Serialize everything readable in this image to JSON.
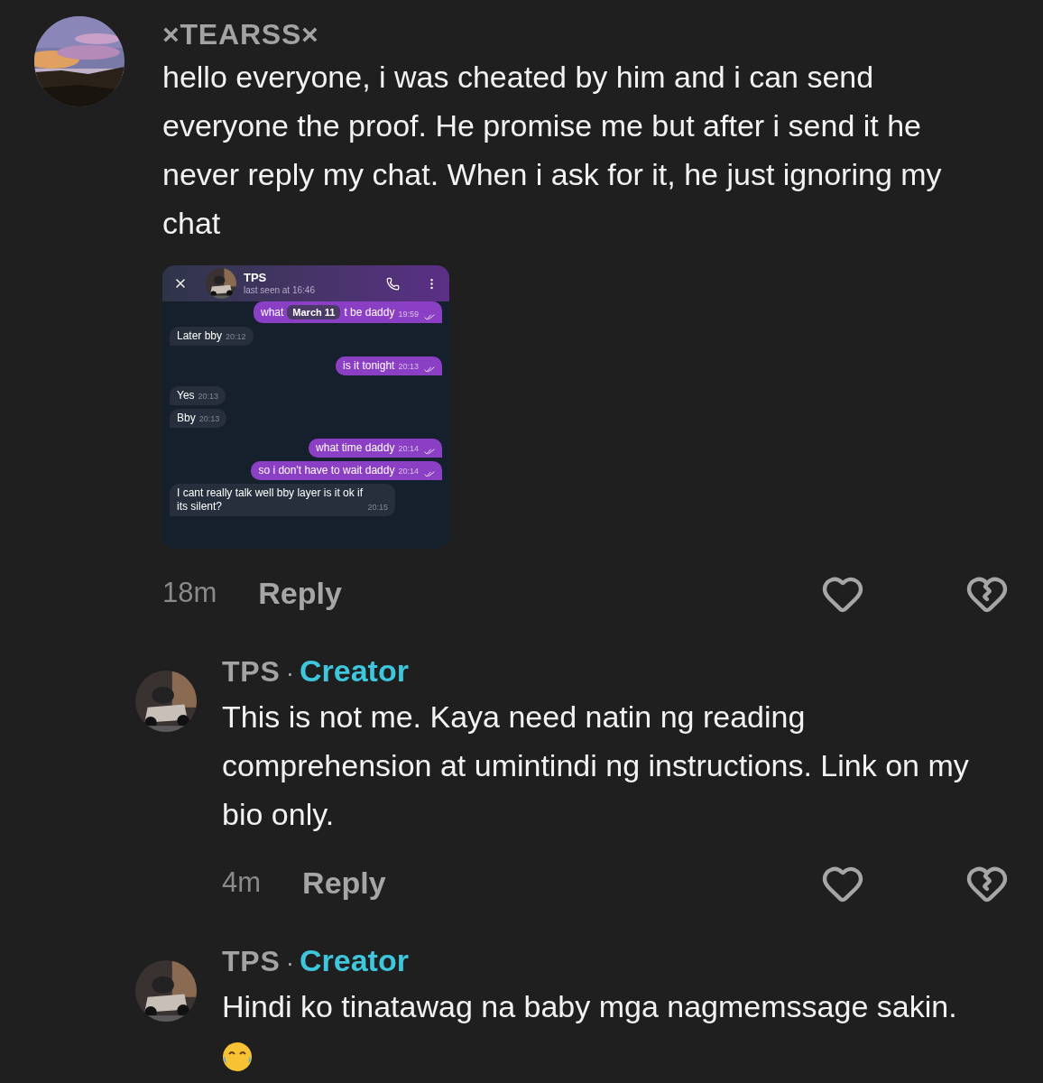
{
  "comments": [
    {
      "kind": "comment",
      "author": "×TEARSS×",
      "text": "hello everyone, i was cheated by him and i can send everyone the proof. He promise me but after i send it he never reply my chat. When i ask for it, he just ignoring my chat",
      "attachment": {
        "kind": "chat_screenshot",
        "title": "TPS",
        "status": "last seen at 16:46",
        "date_pill": "March 11",
        "messages": [
          {
            "kind": "sent",
            "parts": [
              "what",
              "t be daddy"
            ],
            "covered_by_date": true,
            "time": "19:59"
          },
          {
            "kind": "received",
            "parts": [
              "Later bby"
            ],
            "covered_by_date": false,
            "time": "20:12"
          },
          {
            "kind": "sent",
            "parts": [
              "is it tonight"
            ],
            "covered_by_date": false,
            "time": "20:13"
          },
          {
            "kind": "received",
            "parts": [
              "Yes"
            ],
            "covered_by_date": false,
            "time": "20:13"
          },
          {
            "kind": "received",
            "parts": [
              "Bby"
            ],
            "covered_by_date": false,
            "time": "20:13"
          },
          {
            "kind": "sent",
            "parts": [
              "what time daddy"
            ],
            "covered_by_date": false,
            "time": "20:14"
          },
          {
            "kind": "sent",
            "parts": [
              "so i don't have to wait daddy"
            ],
            "covered_by_date": false,
            "time": "20:14"
          },
          {
            "kind": "received",
            "parts": [
              "I cant really talk well bby layer is it ok if its silent?"
            ],
            "covered_by_date": false,
            "time": "20:15"
          }
        ]
      },
      "time": "18m",
      "reply_label": "Reply"
    },
    {
      "kind": "reply",
      "author": "TPS",
      "separator": "·",
      "badge": "Creator",
      "text": "This is not me. Kaya need natin ng reading comprehension at umintindi ng instructions. Link on my bio only.",
      "time": "4m",
      "reply_label": "Reply"
    },
    {
      "kind": "reply",
      "author": "TPS",
      "separator": "·",
      "badge": "Creator",
      "text": "Hindi ko tinatawag na baby mga nagmemssage sakin.",
      "trailing_emoji": true
    }
  ]
}
